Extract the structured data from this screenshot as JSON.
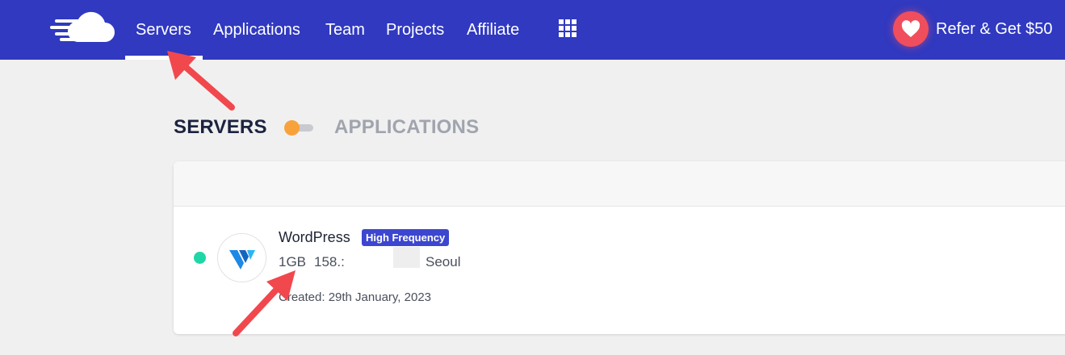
{
  "nav": {
    "items": [
      "Servers",
      "Applications",
      "Team",
      "Projects",
      "Affiliate"
    ],
    "refer_label": "Refer & Get $50"
  },
  "view_toggle": {
    "left_label": "SERVERS",
    "right_label": "APPLICATIONS"
  },
  "server": {
    "name": "WordPress",
    "badge": "High Frequency",
    "size": "1GB",
    "ip_partial": "158.:",
    "location": "Seoul",
    "created": "Created: 29th January, 2023"
  },
  "colors": {
    "nav_bg": "#3039c0",
    "badge_bg": "#3c46cf",
    "status_online": "#1fd7a6",
    "toggle_knob": "#f7a23a",
    "refer_heart": "#f04e5d",
    "annotation_arrow": "#f1484d"
  },
  "icons": {
    "logo": "cloudways-cloud-logo",
    "apps_menu": "grid-icon",
    "refer": "heart-icon",
    "provider": "vultr-logo-icon"
  }
}
